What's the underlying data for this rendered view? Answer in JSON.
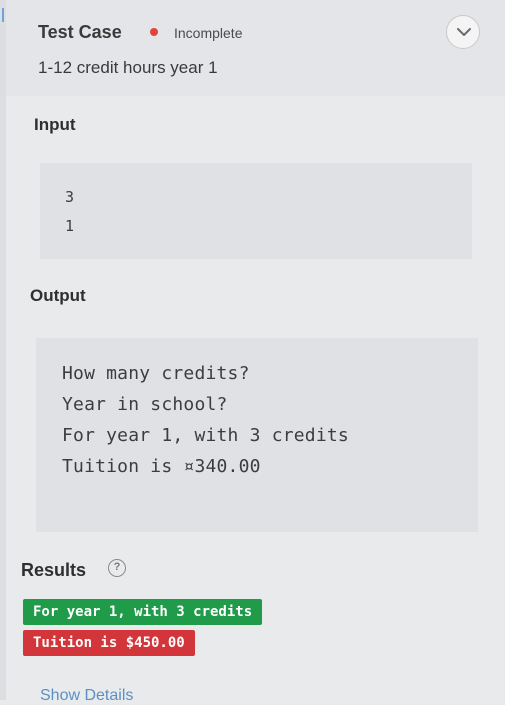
{
  "test_case": {
    "title": "Test Case",
    "status": "Incomplete",
    "status_color": "#e0453d",
    "subtitle": "1-12 credit hours year 1",
    "toggle_icon": "chevron-down-icon"
  },
  "input": {
    "label": "Input",
    "lines": [
      "3",
      "1"
    ]
  },
  "output": {
    "label": "Output",
    "lines": [
      "How many credits?",
      "Year in school?",
      "For year 1, with 3 credits",
      "Tuition is ¤340.00"
    ]
  },
  "results": {
    "label": "Results",
    "help_icon": "?",
    "chips": [
      {
        "text": "For year 1, with 3 credits",
        "status": "match",
        "color": "#1f9b4a"
      },
      {
        "text": "Tuition is $450.00",
        "status": "mismatch",
        "color": "#d3363a"
      }
    ],
    "show_details": "Show Details"
  }
}
